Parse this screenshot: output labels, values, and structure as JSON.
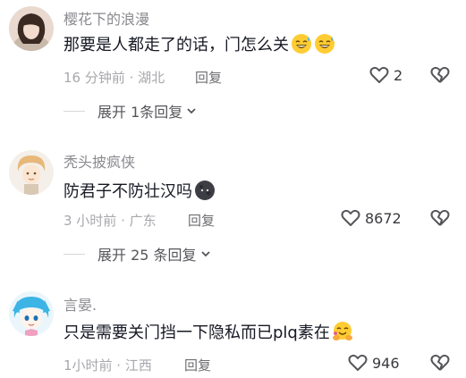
{
  "comments": [
    {
      "username": "樱花下的浪漫",
      "text": "那要是人都走了的话，门怎么关",
      "time_location": "16 分钟前 · 湖北",
      "reply_label": "回复",
      "likes": "2",
      "emoji": "grinning-sweat-emoji",
      "avatar": "avatar-woman",
      "expand_label": "展开 1条回复"
    },
    {
      "username": "秃头披疯侠",
      "text": "防君子不防壮汉吗",
      "time_location": "3 小时前 · 广东",
      "reply_label": "回复",
      "likes": "8672",
      "emoji": "dark-moon-face-emoji",
      "avatar": "avatar-cartoon-blonde",
      "expand_label": "展开 25 条回复"
    },
    {
      "username": "言晏.",
      "text": "只是需要关门挡一下隐私而已plq素在",
      "time_location": "1小时前 · 江西",
      "reply_label": "回复",
      "likes": "946",
      "emoji": "hugging-face-emoji",
      "avatar": "avatar-anime-blue"
    }
  ],
  "colors": {
    "username": "#8a8a8f",
    "text": "#161823",
    "meta": "#a8a8ad"
  }
}
